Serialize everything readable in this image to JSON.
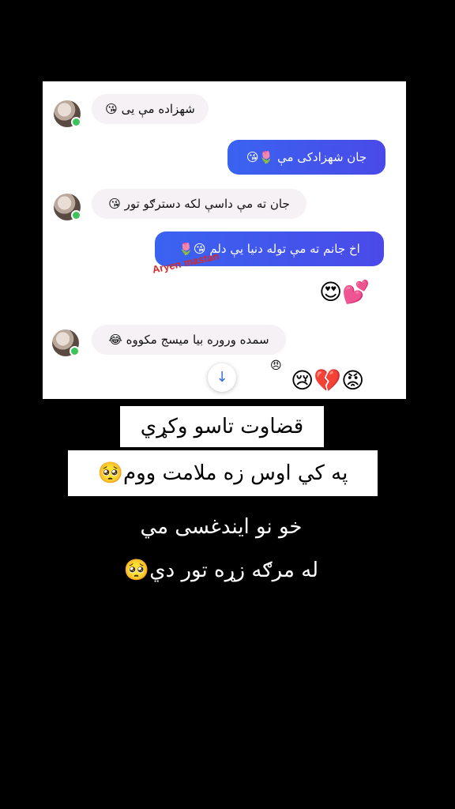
{
  "chat": {
    "messages": [
      {
        "side": "in",
        "text": "شهزاده مې یی",
        "emoji": "😘"
      },
      {
        "side": "out",
        "text": "جان شهزادکی مې",
        "emoji": "🌷😘"
      },
      {
        "side": "in",
        "text": "جان ته مې داسې لکه دسترګو تور",
        "emoji": "😘"
      },
      {
        "side": "out",
        "text": "اخ جانم ته مې توله دنیا یې دلم",
        "emoji": "😘🌷"
      },
      {
        "side": "in",
        "text": "سمده وروره بیا میسج مکووه",
        "emoji": "😂"
      }
    ],
    "watermark": "Aryen mastan",
    "reaction_love": "😍💕",
    "reaction_small": "😠",
    "reaction_row": "😢💔😡",
    "scroll_icon": "↓"
  },
  "captions": {
    "line1": "قضاوت تاسو وکړي",
    "line2": "په کي اوس زه ملامت ووم🥺",
    "line3": "خو نو ایندغسی مي",
    "line4": "له مرګه زړه تور دي🥺"
  },
  "colors": {
    "outgoing_bubble": "#3a63f0",
    "incoming_bubble": "#f5f1f4",
    "online_dot": "#3cc45a",
    "watermark": "#d62a2a"
  }
}
